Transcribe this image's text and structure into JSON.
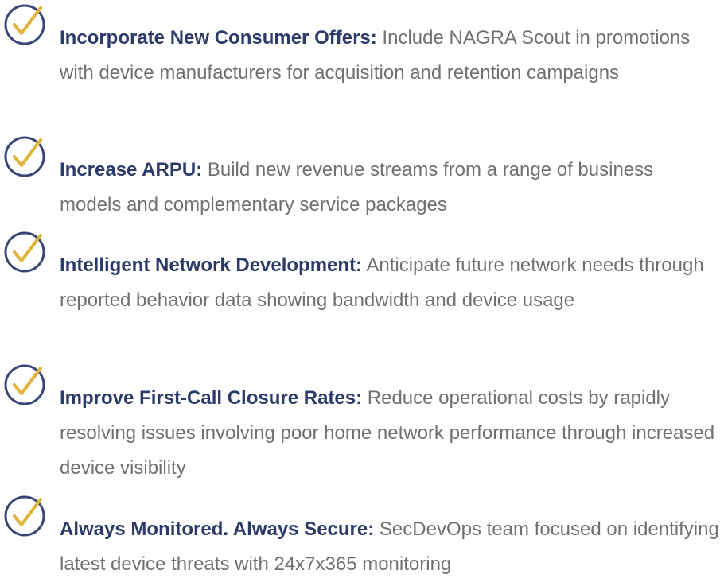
{
  "benefits": [
    {
      "title": "Incorporate New Consumer Offers:",
      "description": "Include NAGRA Scout in promotions with device manufacturers for acquisition and retention campaigns",
      "icon": "check-circle-icon"
    },
    {
      "title": "Increase ARPU:",
      "description": "Build new revenue streams from a range of business models and complementary service packages",
      "icon": "check-circle-icon"
    },
    {
      "title": "Intelligent Network Development:",
      "description": "Anticipate future network needs through reported behavior data showing bandwidth and device usage",
      "icon": "check-circle-icon"
    },
    {
      "title": "Improve First-Call Closure Rates:",
      "description": "Reduce operational costs by rapidly resolving issues involving poor home network performance through increased device visibility",
      "icon": "check-circle-icon"
    },
    {
      "title": "Always Monitored. Always Secure:",
      "description": "SecDevOps team focused on identifying latest device threats with 24x7x365 monitoring",
      "icon": "check-circle-icon"
    }
  ],
  "colors": {
    "circle": "#3a4478",
    "check": "#e2b33a",
    "title": "#2c3a69",
    "body": "#707070"
  }
}
